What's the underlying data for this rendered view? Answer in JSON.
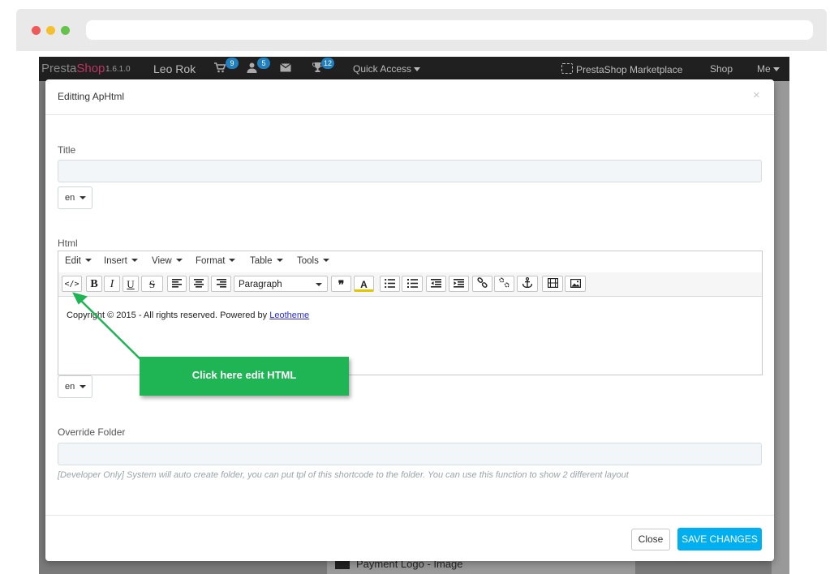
{
  "topnav": {
    "logo_presta": "Presta",
    "logo_shop": "Shop",
    "version": "1.6.1.0",
    "store_name": "Leo Rok",
    "orders_badge": "9",
    "customers_badge": "5",
    "notifications_badge": "12",
    "quick_access": "Quick Access",
    "marketplace": "PrestaShop Marketplace",
    "shop": "Shop",
    "me": "Me"
  },
  "background": {
    "bottom_item": "Payment Logo - Image"
  },
  "modal": {
    "title": "Editting ApHtml",
    "close_icon": "×",
    "title_label": "Title",
    "title_value": "",
    "lang_title": "en",
    "html_label": "Html",
    "menu": [
      "Edit",
      "Insert",
      "View",
      "Format",
      "Table",
      "Tools"
    ],
    "toolbar": {
      "code": "</>",
      "bold": "B",
      "italic": "I",
      "underline": "U",
      "strike": "S",
      "format_select": "Paragraph",
      "blockquote": "❞",
      "text_color": "A"
    },
    "content_text": "Copyright © 2015 - All rights reserved. Powered by ",
    "content_link": "Leotheme",
    "lang_html": "en",
    "override_label": "Override Folder",
    "override_value": "",
    "help_text": "[Developer Only] System will auto create folder, you can put tpl of this shortcode to the folder. You can use this function to show 2 different layout",
    "close_button": "Close",
    "save_button": "SAVE CHANGES"
  },
  "annotation": {
    "callout_text": "Click here edit HTML"
  },
  "colors": {
    "accent": "#00aff0",
    "callout": "#1fb454",
    "topnav": "#202020",
    "brand_shop": "#bf3361"
  }
}
